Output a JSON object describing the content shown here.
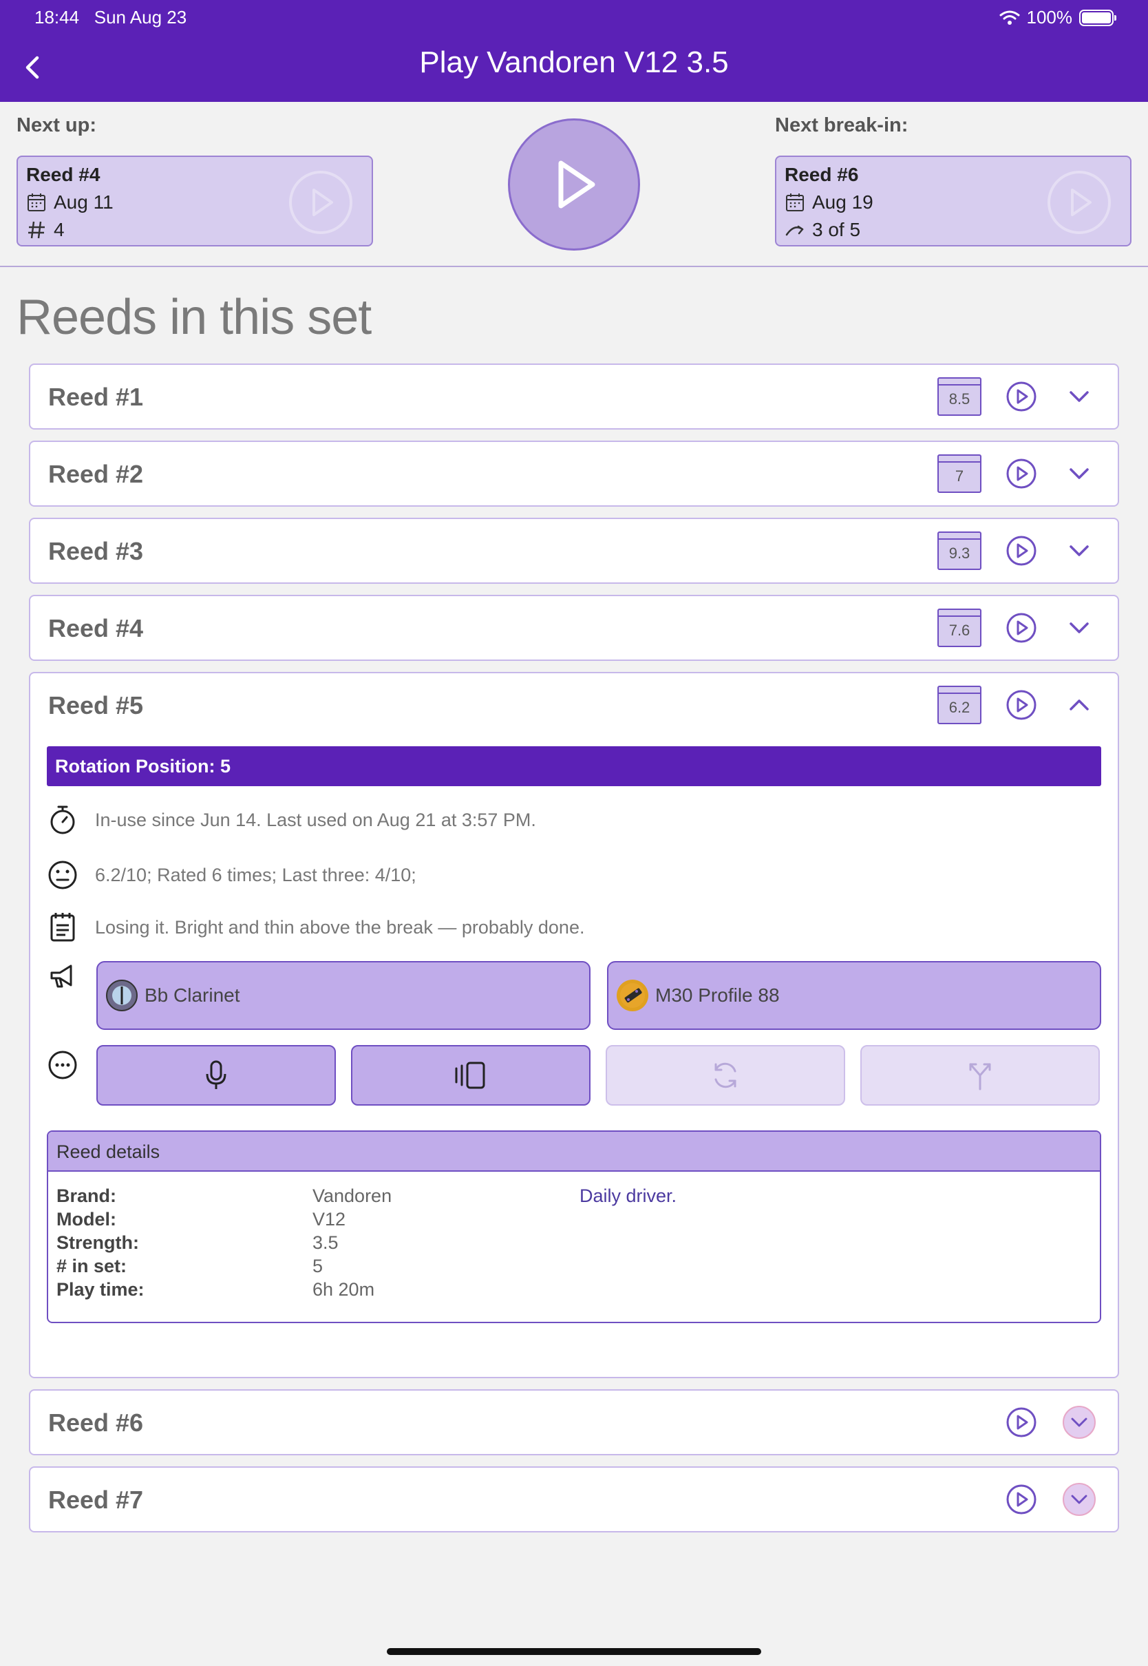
{
  "status": {
    "time": "18:44",
    "date": "Sun Aug 23",
    "battery": "100%"
  },
  "header": {
    "title": "Play Vandoren V12 3.5"
  },
  "next_up": {
    "label": "Next up:",
    "reed": "Reed #4",
    "date": "Aug 11",
    "count": "4"
  },
  "next_break_in": {
    "label": "Next break-in:",
    "reed": "Reed #6",
    "date": "Aug 19",
    "progress": "3 of 5"
  },
  "section_title": "Reeds in this set",
  "reeds": [
    {
      "name": "Reed #1",
      "rating": "8.5"
    },
    {
      "name": "Reed #2",
      "rating": "7"
    },
    {
      "name": "Reed #3",
      "rating": "9.3"
    },
    {
      "name": "Reed #4",
      "rating": "7.6"
    },
    {
      "name": "Reed #5",
      "rating": "6.2"
    },
    {
      "name": "Reed #6"
    },
    {
      "name": "Reed #7"
    }
  ],
  "expanded": {
    "rotation": "Rotation Position: 5",
    "usage": "In-use since Jun 14. Last used on Aug 21 at 3:57 PM.",
    "ratings": "6.2/10; Rated 6 times; Last three: 4/10;",
    "notes": "Losing it. Bright and thin above the break — probably done.",
    "instrument": "Bb Clarinet",
    "mouthpiece": "M30 Profile 88",
    "details": {
      "header": "Reed details",
      "brand_label": "Brand:",
      "brand": "Vandoren",
      "model_label": "Model:",
      "model": "V12",
      "strength_label": "Strength:",
      "strength": "3.5",
      "inset_label": "# in set:",
      "inset": "5",
      "playtime_label": "Play time:",
      "playtime": "6h 20m",
      "note": "Daily driver."
    }
  },
  "colors": {
    "primary": "#5b21b6",
    "accent_light": "#c0acea",
    "card_bg": "#d7cdef",
    "border": "#c7b8ea"
  }
}
